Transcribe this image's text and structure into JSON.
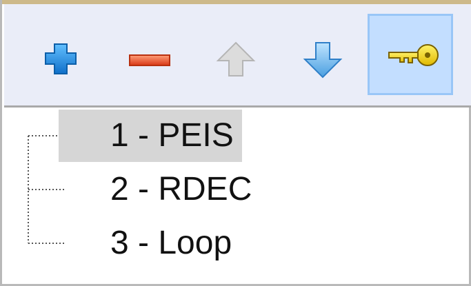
{
  "toolbar": {
    "buttons": [
      {
        "id": "add",
        "icon": "plus-icon",
        "color": "#1e8ae6"
      },
      {
        "id": "remove",
        "icon": "minus-icon",
        "color": "#e14a2a"
      },
      {
        "id": "move-up",
        "icon": "arrow-up-icon",
        "color": "#c8c8c8"
      },
      {
        "id": "move-down",
        "icon": "arrow-down-icon",
        "color": "#6bb2e8"
      },
      {
        "id": "key",
        "icon": "key-icon",
        "color": "#f2d20a",
        "active": true
      }
    ],
    "active_bg": "#c3deff"
  },
  "tree": {
    "items": [
      {
        "label": "1 - PEIS",
        "selected": true
      },
      {
        "label": "2 - RDEC",
        "selected": false
      },
      {
        "label": "3 - Loop",
        "selected": false
      }
    ],
    "selection_bg": "#d6d6d6"
  }
}
